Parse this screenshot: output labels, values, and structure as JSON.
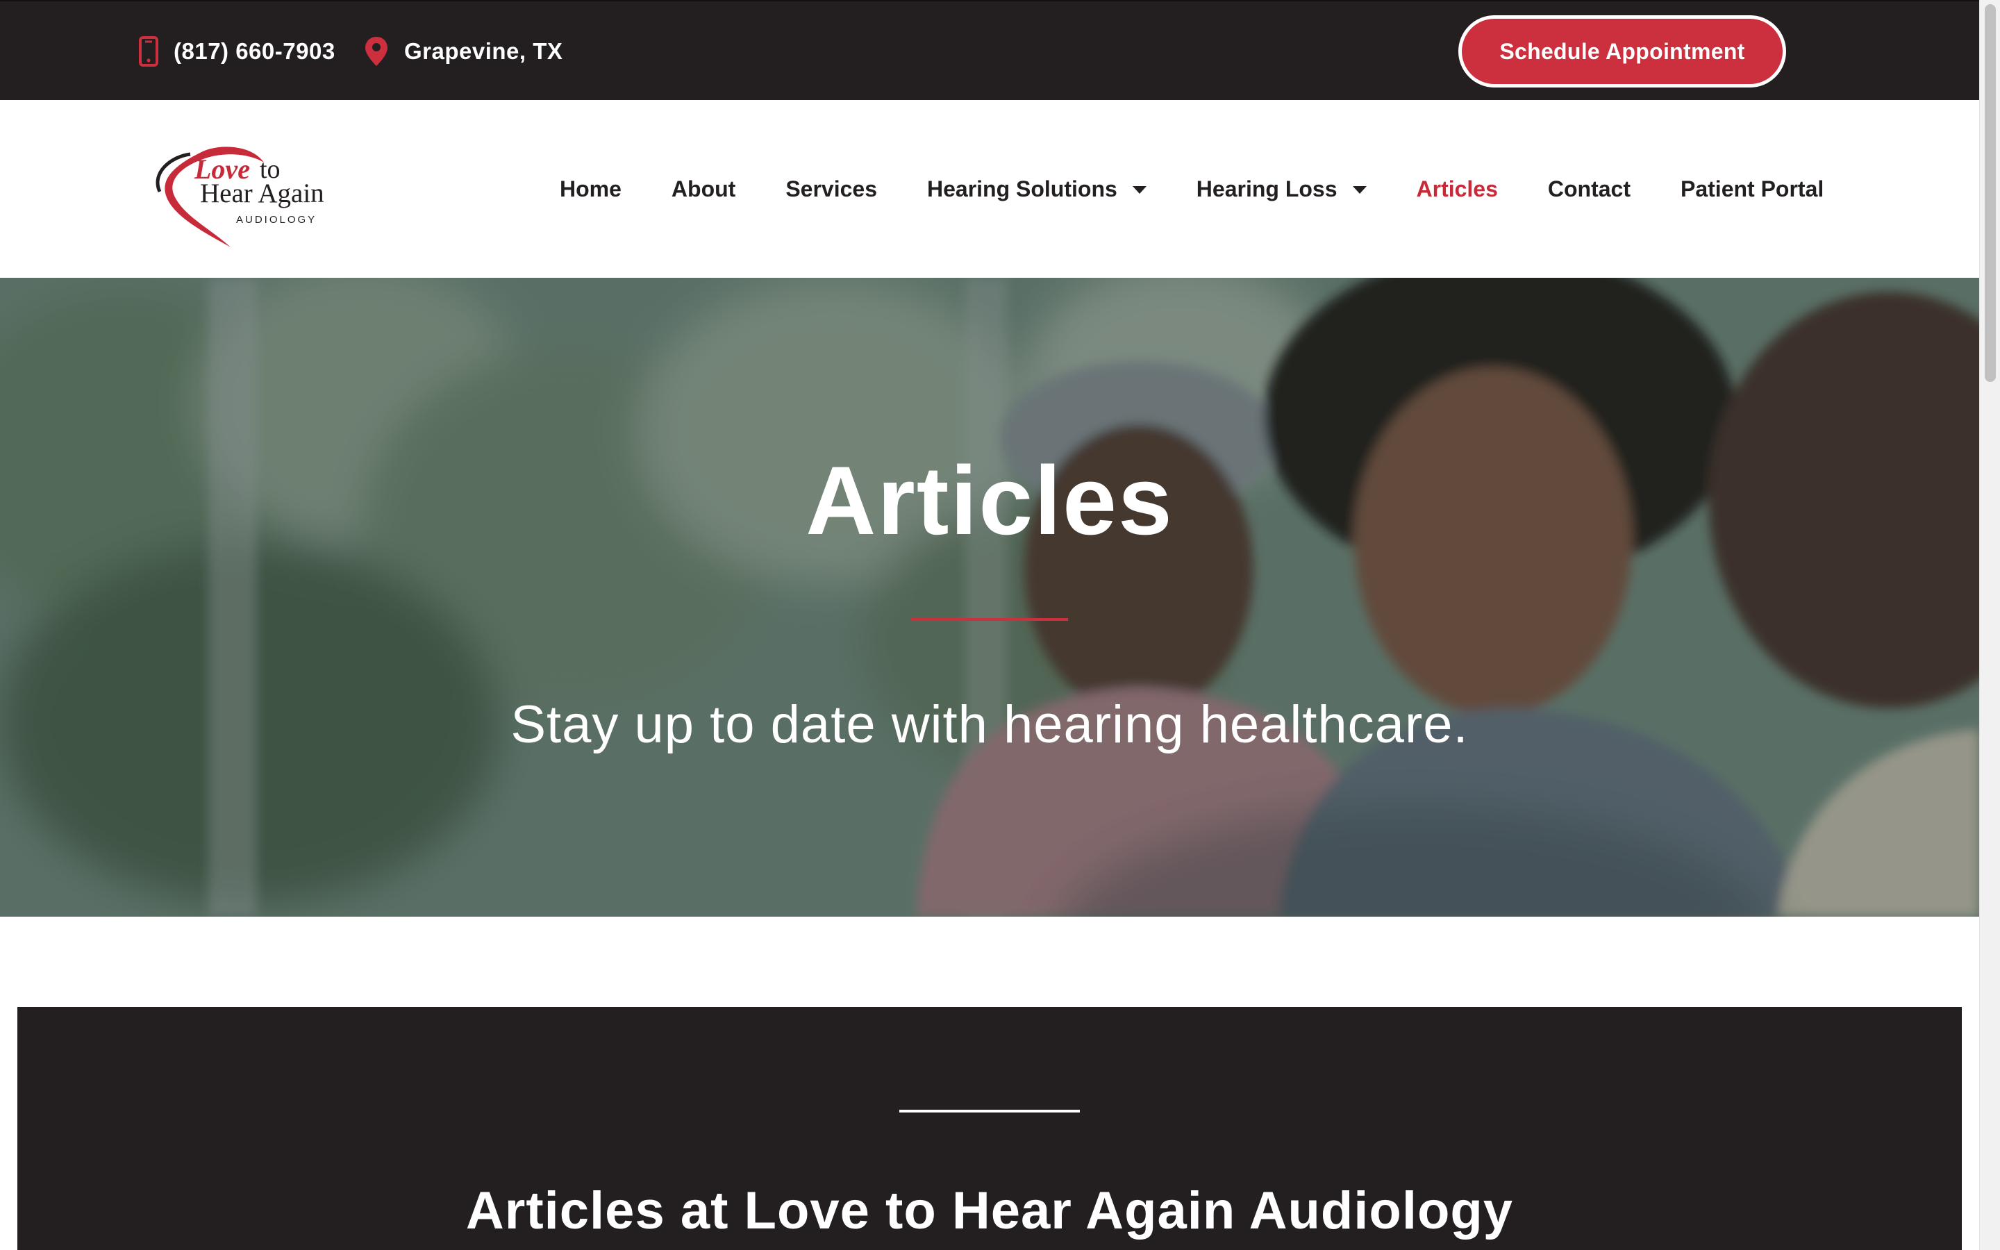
{
  "topbar": {
    "phone": "(817) 660-7903",
    "location": "Grapevine, TX",
    "schedule_label": "Schedule Appointment",
    "phone_icon": "phone-icon",
    "location_icon": "map-pin-icon"
  },
  "logo": {
    "love": "Love",
    "to": "to",
    "hear_again": "Hear Again",
    "subtitle": "AUDIOLOGY"
  },
  "nav": {
    "items": [
      {
        "label": "Home"
      },
      {
        "label": "About"
      },
      {
        "label": "Services"
      },
      {
        "label": "Hearing Solutions",
        "dropdown": true
      },
      {
        "label": "Hearing Loss",
        "dropdown": true
      },
      {
        "label": "Articles",
        "active": true
      },
      {
        "label": "Contact"
      },
      {
        "label": "Patient Portal"
      }
    ]
  },
  "hero": {
    "title": "Articles",
    "subtitle": "Stay up to date with hearing healthcare."
  },
  "section": {
    "heading": "Articles at Love to Hear Again Audiology"
  },
  "colors": {
    "brand_red": "#cc2f3d",
    "dark": "#231f20",
    "white": "#ffffff"
  }
}
